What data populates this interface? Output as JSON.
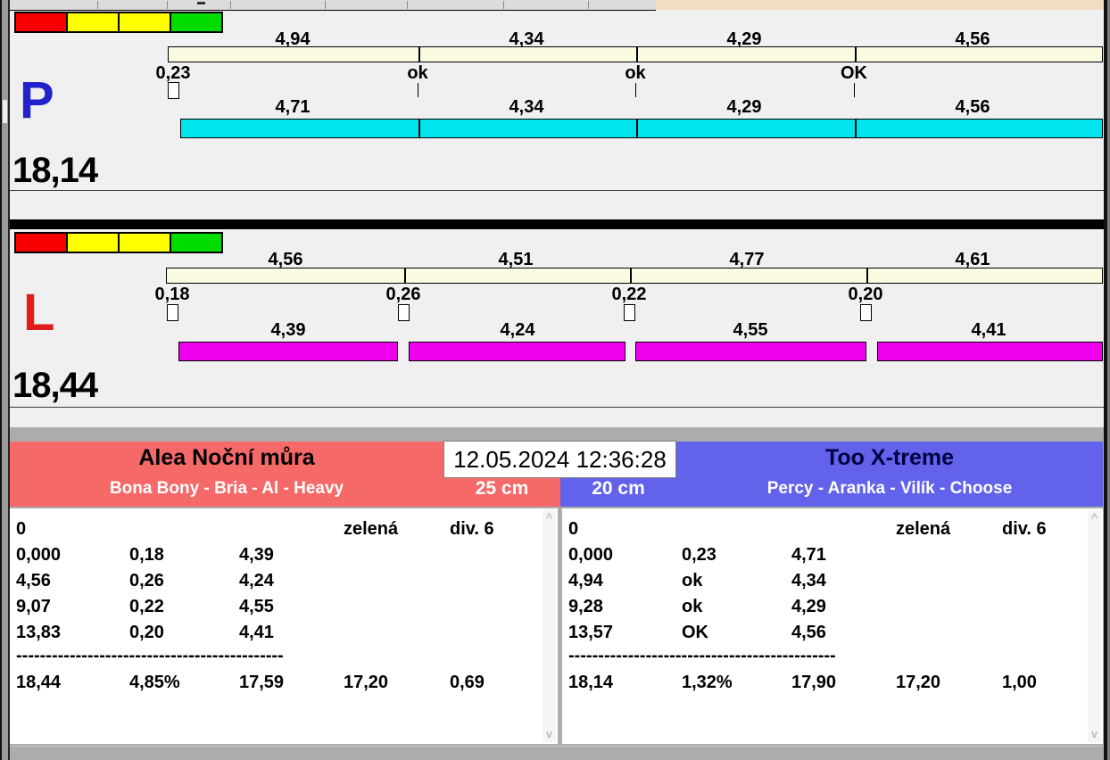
{
  "clock": {
    "datetime": "12.05.2024 12:36:28"
  },
  "lanes": [
    {
      "letter": "P",
      "total": "18,14",
      "splits_top": [
        "4,94",
        "4,34",
        "4,29",
        "4,56"
      ],
      "checkpoints": [
        "0,23",
        "ok",
        "ok",
        "OK"
      ],
      "splits_bottom": [
        "4,71",
        "4,34",
        "4,29",
        "4,56"
      ]
    },
    {
      "letter": "L",
      "total": "18,44",
      "splits_top": [
        "4,56",
        "4,51",
        "4,77",
        "4,61"
      ],
      "checkpoints": [
        "0,18",
        "0,26",
        "0,22",
        "0,20"
      ],
      "splits_bottom": [
        "4,39",
        "4,24",
        "4,55",
        "4,41"
      ]
    }
  ],
  "teams": {
    "left": {
      "name": "Alea Noční můra",
      "lineup": "Bona Bony - Bria - Al - Heavy",
      "jump_height": "25 cm",
      "result": {
        "faults": "0",
        "light": "zelená",
        "division": "div. 6",
        "laps": [
          [
            "0,000",
            "0,18",
            "4,39"
          ],
          [
            "4,56",
            "0,26",
            "4,24"
          ],
          [
            "9,07",
            "0,22",
            "4,55"
          ],
          [
            "13,83",
            "0,20",
            "4,41"
          ]
        ],
        "separator": "---------------------------------------------",
        "summary": [
          "18,44",
          "4,85%",
          "17,59",
          "17,20",
          "0,69"
        ]
      }
    },
    "right": {
      "name": "Too X-treme",
      "lineup": "Percy - Aranka - Vilík - Choose",
      "jump_height": "20 cm",
      "result": {
        "faults": "0",
        "light": "zelená",
        "division": "div. 6",
        "laps": [
          [
            "0,000",
            "0,23",
            "4,71"
          ],
          [
            "4,94",
            "ok",
            "4,34"
          ],
          [
            "9,28",
            "ok",
            "4,29"
          ],
          [
            "13,57",
            "OK",
            "4,56"
          ]
        ],
        "separator": "---------------------------------------------",
        "summary": [
          "18,14",
          "1,32%",
          "17,90",
          "17,20",
          "1,00"
        ]
      }
    }
  },
  "icons": {
    "scroll_up": "^",
    "scroll_down": "v"
  },
  "colors": {
    "lane_p_letter": "#2222CC",
    "lane_l_letter": "#E01D1D",
    "lane_p_bar": "#00E5EE",
    "lane_l_bar": "#EE00EE",
    "split_scale_bar": "#FBFBE2",
    "team_left": "#F56969",
    "team_right": "#6262EA",
    "start_lights": [
      "#F80000",
      "#FFFF00",
      "#FFFF00",
      "#00DC00"
    ]
  }
}
